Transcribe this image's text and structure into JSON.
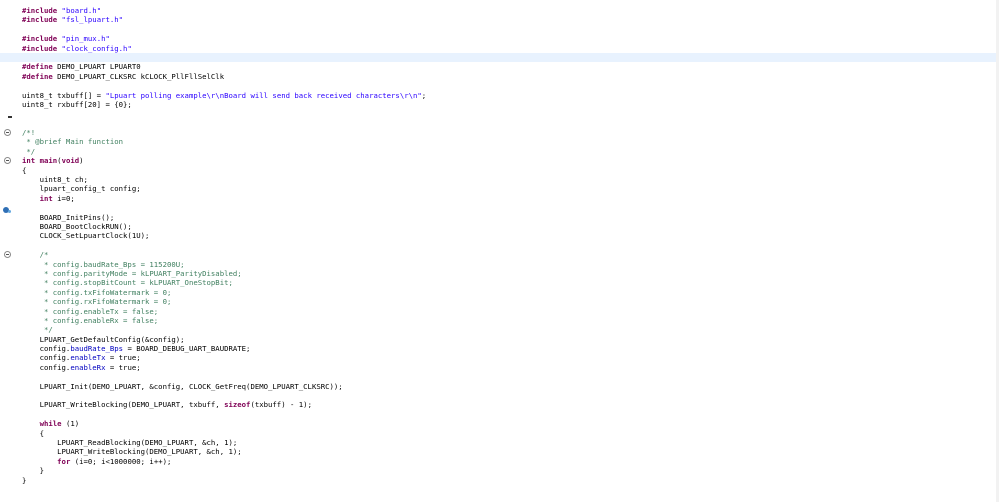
{
  "editor": {
    "lines": [
      {
        "parts": [
          [
            "kw",
            "#include"
          ],
          [
            "",
            ""
          ],
          [
            "str",
            " \"board.h\""
          ]
        ]
      },
      {
        "parts": [
          [
            "kw",
            "#include"
          ],
          [
            "str",
            " \"fsl_lpuart.h\""
          ]
        ]
      },
      {
        "parts": []
      },
      {
        "parts": [
          [
            "kw",
            "#include"
          ],
          [
            "str",
            " \"pin_mux.h\""
          ]
        ]
      },
      {
        "parts": [
          [
            "kw",
            "#include"
          ],
          [
            "str",
            " \"clock_config.h\""
          ]
        ]
      },
      {
        "parts": [],
        "hl": true
      },
      {
        "parts": [
          [
            "kw",
            "#define"
          ],
          [
            "",
            " DEMO_LPUART LPUART0"
          ]
        ]
      },
      {
        "parts": [
          [
            "kw",
            "#define"
          ],
          [
            "",
            " DEMO_LPUART_CLKSRC kCLOCK_PllFllSelClk"
          ]
        ]
      },
      {
        "parts": []
      },
      {
        "parts": [
          [
            "",
            "uint8_t txbuff[] = "
          ],
          [
            "str",
            "\"Lpuart polling example\\r\\nBoard will send back received characters\\r\\n\""
          ],
          [
            "",
            ";"
          ]
        ]
      },
      {
        "parts": [
          [
            "",
            "uint8_t rxbuff[20] = {0};"
          ]
        ]
      },
      {
        "parts": []
      },
      {
        "parts": []
      },
      {
        "parts": [
          [
            "cmt",
            "/*!"
          ]
        ],
        "fold": true
      },
      {
        "parts": [
          [
            "cmt",
            " * @brief Main function"
          ]
        ]
      },
      {
        "parts": [
          [
            "cmt",
            " */"
          ]
        ]
      },
      {
        "parts": [
          [
            "kw",
            "int"
          ],
          [
            "",
            " "
          ],
          [
            "kw",
            "main"
          ],
          [
            "",
            "("
          ],
          [
            "kw",
            "void"
          ],
          [
            "",
            ")"
          ]
        ],
        "fold": true
      },
      {
        "parts": [
          [
            "",
            "{"
          ]
        ]
      },
      {
        "parts": [
          [
            "",
            "    uint8_t ch;"
          ]
        ]
      },
      {
        "parts": [
          [
            "",
            "    lpuart_config_t config;"
          ]
        ]
      },
      {
        "parts": [
          [
            "",
            "    "
          ],
          [
            "kw",
            "int"
          ],
          [
            "",
            " i=0;"
          ]
        ]
      },
      {
        "parts": []
      },
      {
        "parts": [
          [
            "",
            "    BOARD_InitPins();"
          ]
        ]
      },
      {
        "parts": [
          [
            "",
            "    BOARD_BootClockRUN();"
          ]
        ]
      },
      {
        "parts": [
          [
            "",
            "    CLOCK_SetLpuartClock(1U);"
          ]
        ]
      },
      {
        "parts": []
      },
      {
        "parts": [
          [
            "cmt",
            "    /*"
          ]
        ],
        "fold": true
      },
      {
        "parts": [
          [
            "cmt",
            "     * config.baudRate_Bps = 115200U;"
          ]
        ]
      },
      {
        "parts": [
          [
            "cmt",
            "     * config.parityMode = kLPUART_ParityDisabled;"
          ]
        ]
      },
      {
        "parts": [
          [
            "cmt",
            "     * config.stopBitCount = kLPUART_OneStopBit;"
          ]
        ]
      },
      {
        "parts": [
          [
            "cmt",
            "     * config.txFifoWatermark = 0;"
          ]
        ]
      },
      {
        "parts": [
          [
            "cmt",
            "     * config.rxFifoWatermark = 0;"
          ]
        ]
      },
      {
        "parts": [
          [
            "cmt",
            "     * config.enableTx = false;"
          ]
        ]
      },
      {
        "parts": [
          [
            "cmt",
            "     * config.enableRx = false;"
          ]
        ]
      },
      {
        "parts": [
          [
            "cmt",
            "     */"
          ]
        ]
      },
      {
        "parts": [
          [
            "",
            "    LPUART_GetDefaultConfig(&config);"
          ]
        ]
      },
      {
        "parts": [
          [
            "",
            "    config."
          ],
          [
            "fld",
            "baudRate_Bps"
          ],
          [
            "",
            " = BOARD_DEBUG_UART_BAUDRATE;"
          ]
        ]
      },
      {
        "parts": [
          [
            "",
            "    config."
          ],
          [
            "fld",
            "enableTx"
          ],
          [
            "",
            " = true;"
          ]
        ]
      },
      {
        "parts": [
          [
            "",
            "    config."
          ],
          [
            "fld",
            "enableRx"
          ],
          [
            "",
            " = true;"
          ]
        ]
      },
      {
        "parts": []
      },
      {
        "parts": [
          [
            "",
            "    LPUART_Init(DEMO_LPUART, &config, CLOCK_GetFreq(DEMO_LPUART_CLKSRC));"
          ]
        ]
      },
      {
        "parts": []
      },
      {
        "parts": [
          [
            "",
            "    LPUART_WriteBlocking(DEMO_LPUART, txbuff, "
          ],
          [
            "kw",
            "sizeof"
          ],
          [
            "",
            "(txbuff) - 1);"
          ]
        ]
      },
      {
        "parts": []
      },
      {
        "parts": [
          [
            "",
            "    "
          ],
          [
            "kw",
            "while"
          ],
          [
            "",
            " (1)"
          ]
        ]
      },
      {
        "parts": [
          [
            "",
            "    {"
          ]
        ]
      },
      {
        "parts": [
          [
            "",
            "        LPUART_ReadBlocking(DEMO_LPUART, &ch, 1);"
          ]
        ]
      },
      {
        "parts": [
          [
            "",
            "        LPUART_WriteBlocking(DEMO_LPUART, &ch, 1);"
          ]
        ]
      },
      {
        "parts": [
          [
            "",
            "        "
          ],
          [
            "kw",
            "for"
          ],
          [
            "",
            " (i=0; i<1000000; i++);"
          ]
        ]
      },
      {
        "parts": [
          [
            "",
            "    }"
          ]
        ]
      },
      {
        "parts": [
          [
            "",
            "}"
          ]
        ]
      }
    ]
  },
  "gutter": {
    "fold_icon": "collapse-circle-icon",
    "marker_icon": "dash-marker-icon",
    "breakpoint_icon": "debug-marker-icon"
  },
  "colors": {
    "keyword": "#7f0055",
    "string": "#2a00ff",
    "comment": "#3f7f5f",
    "field": "#0000c0",
    "current_line": "#e8f2fe"
  }
}
